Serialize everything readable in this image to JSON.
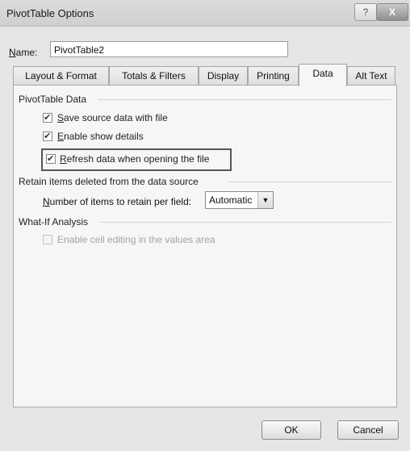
{
  "window": {
    "title": "PivotTable Options",
    "help_label": "?",
    "close_label": "X"
  },
  "name_field": {
    "label_prefix": "",
    "label_hotkey": "N",
    "label_rest": "ame:",
    "value": "PivotTable2"
  },
  "tabs": [
    {
      "label": "Layout & Format",
      "active": false
    },
    {
      "label": "Totals & Filters",
      "active": false
    },
    {
      "label": "Display",
      "active": false
    },
    {
      "label": "Printing",
      "active": false
    },
    {
      "label": "Data",
      "active": true
    },
    {
      "label": "Alt Text",
      "active": false
    }
  ],
  "pivot_data": {
    "heading": "PivotTable Data",
    "save_source": {
      "hotkey": "S",
      "rest": "ave source data with file",
      "checked": true
    },
    "enable_details": {
      "hotkey": "E",
      "rest": "nable show details",
      "checked": true
    },
    "refresh_on_open": {
      "hotkey": "R",
      "rest": "efresh data when opening the file",
      "checked": true
    }
  },
  "retain": {
    "heading": "Retain items deleted from the data source",
    "label_hotkey": "N",
    "label_rest": "umber of items to retain per field:",
    "selected": "Automatic"
  },
  "what_if": {
    "heading": "What-If Analysis",
    "cell_editing": {
      "label": "Enable cell editing in the values area",
      "checked": false,
      "enabled": false
    }
  },
  "buttons": {
    "ok": "OK",
    "cancel": "Cancel"
  }
}
